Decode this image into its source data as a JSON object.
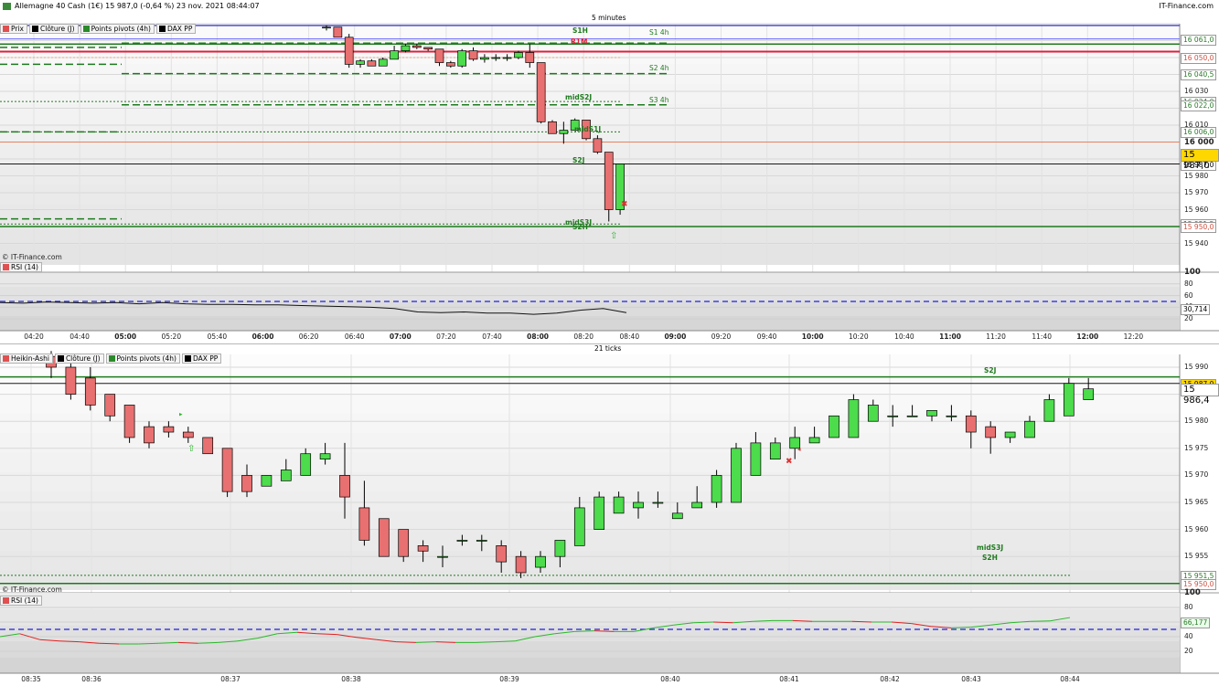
{
  "window": {
    "title": "Allemagne 40 Cash (1€) 15 987,0 (-0,64 %) 23 nov. 2021 08:44:07",
    "brand": "IT-Finance.com"
  },
  "top_chart": {
    "period_label": "5 minutes",
    "legend": [
      "Prix",
      "Clôture (J)",
      "Points pivots (4h)",
      "DAX PP"
    ],
    "legend_colors": [
      "#e05050",
      "#000000",
      "#2a8a2a",
      "#000000"
    ],
    "credit": "© IT-Finance.com",
    "price_labels": [
      "16 061,0",
      "16 050,0",
      "16 040,5",
      "16 030",
      "16 024,0",
      "16 022,0",
      "16 010",
      "16 006,0",
      "16 000",
      "15 980",
      "15 970",
      "15 960",
      "15 951,5",
      "15 950,0",
      "15 940",
      "15 987,0"
    ],
    "current_price": "15 987,0",
    "annotations": [
      "S1H",
      "S1 4h",
      "R1M",
      "S2 4h",
      "midS2J",
      "S3 4h",
      "midS1J",
      "S2J",
      "midS3J",
      "S2H"
    ],
    "rsi_label": "RSI (14)",
    "rsi_axis": [
      "100",
      "80",
      "60",
      "40",
      "20"
    ],
    "rsi_value": "30,714",
    "time_labels": [
      "04:20",
      "04:40",
      "05:00",
      "05:20",
      "05:40",
      "06:00",
      "06:20",
      "06:40",
      "07:00",
      "07:20",
      "07:40",
      "08:00",
      "08:20",
      "08:40",
      "09:00",
      "09:20",
      "09:40",
      "10:00",
      "10:20",
      "10:40",
      "11:00",
      "11:20",
      "11:40",
      "12:00",
      "12:20"
    ],
    "time_labels_bold": [
      "05:00",
      "06:00",
      "07:00",
      "08:00",
      "09:00",
      "10:00",
      "11:00",
      "12:00"
    ]
  },
  "bottom_chart": {
    "period_label": "21 ticks",
    "legend": [
      "Heikin-Ashi",
      "Clôture (J)",
      "Points pivots (4h)",
      "DAX PP"
    ],
    "legend_colors": [
      "#e05050",
      "#000000",
      "#2a8a2a",
      "#000000"
    ],
    "credit": "© IT-Finance.com",
    "price_labels": [
      "15 990",
      "15 987,0",
      "15 980",
      "15 975",
      "15 970",
      "15 965",
      "15 960",
      "15 955",
      "15 951,5",
      "15 950,0"
    ],
    "current_price": "15 986,4",
    "annotations": [
      "S2J",
      "midS3J",
      "S2H"
    ],
    "rsi_label": "RSI (14)",
    "rsi_axis": [
      "100",
      "80",
      "60",
      "40",
      "20"
    ],
    "rsi_value": "66,177",
    "time_labels": [
      "08:35",
      "08:36",
      "08:37",
      "08:38",
      "08:39",
      "08:40",
      "08:41",
      "08:42",
      "08:43",
      "08:44"
    ]
  },
  "colors": {
    "up": "#4cdc4c",
    "down": "#e87070",
    "pivot_green": "#1e7a1e",
    "resistance_red": "#e01e3c",
    "rsi_blue": "#2020e0",
    "current_price_bg": "#ffd700"
  },
  "chart_data": [
    {
      "type": "candlestick",
      "title": "5 minutes",
      "series": [
        {
          "name": "Prix",
          "ohlc": [
            [
              16068,
              16069,
              16066,
              16068
            ],
            [
              16068,
              16068,
              16062,
              16062
            ],
            [
              16062,
              16064,
              16044,
              16046
            ],
            [
              16046,
              16049,
              16044,
              16048
            ],
            [
              16048,
              16049,
              16045,
              16045
            ],
            [
              16045,
              16050,
              16045,
              16049
            ],
            [
              16049,
              16057,
              16049,
              16054
            ],
            [
              16054,
              16058,
              16053,
              16057
            ],
            [
              16057,
              16058,
              16055,
              16056
            ],
            [
              16056,
              16056,
              16054,
              16055
            ],
            [
              16055,
              16055,
              16045,
              16047
            ],
            [
              16047,
              16048,
              16044,
              16045
            ],
            [
              16045,
              16055,
              16044,
              16054
            ],
            [
              16054,
              16056,
              16048,
              16049
            ],
            [
              16049,
              16052,
              16047,
              16050
            ],
            [
              16050,
              16052,
              16048,
              16050
            ],
            [
              16050,
              16052,
              16048,
              16050
            ],
            [
              16050,
              16054,
              16049,
              16053
            ],
            [
              16053,
              16058,
              16044,
              16047
            ],
            [
              16047,
              16047,
              16011,
              16012
            ],
            [
              16012,
              16013,
              16005,
              16005
            ],
            [
              16005,
              16012,
              15999,
              16007
            ],
            [
              16007,
              16014,
              16007,
              16013
            ],
            [
              16013,
              16013,
              16001,
              16002
            ],
            [
              16002,
              16004,
              15993,
              15994
            ],
            [
              15994,
              15994,
              15953,
              15960
            ],
            [
              15960,
              15987,
              15957,
              15987
            ]
          ]
        }
      ],
      "rsi": [
        48,
        47,
        49,
        48,
        47,
        48,
        46,
        48,
        46,
        45,
        45,
        44,
        44,
        43,
        42,
        41,
        40,
        38,
        32,
        31,
        32,
        30,
        30,
        28,
        30,
        35,
        38,
        30.714
      ]
    },
    {
      "type": "candlestick",
      "title": "21 ticks",
      "series": [
        {
          "name": "Heikin-Ashi",
          "ohlc": [
            [
              15992,
              15993,
              15988,
              15990
            ],
            [
              15990,
              15991,
              15984,
              15985
            ],
            [
              15988,
              15990,
              15982,
              15983
            ],
            [
              15985,
              15985,
              15980,
              15981
            ],
            [
              15983,
              15983,
              15976,
              15977
            ],
            [
              15979,
              15980,
              15975,
              15976
            ],
            [
              15979,
              15980,
              15977,
              15978
            ],
            [
              15978,
              15979,
              15976,
              15977
            ],
            [
              15977,
              15977,
              15974,
              15974
            ],
            [
              15975,
              15975,
              15966,
              15967
            ],
            [
              15970,
              15972,
              15966,
              15967
            ],
            [
              15968,
              15970,
              15968,
              15970
            ],
            [
              15969,
              15973,
              15969,
              15971
            ],
            [
              15970,
              15975,
              15970,
              15974
            ],
            [
              15973,
              15976,
              15972,
              15974
            ],
            [
              15970,
              15976,
              15962,
              15966
            ],
            [
              15964,
              15969,
              15957,
              15958
            ],
            [
              15962,
              15962,
              15955,
              15955
            ],
            [
              15960,
              15960,
              15954,
              15955
            ],
            [
              15957,
              15958,
              15954,
              15956
            ],
            [
              15955,
              15957,
              15953,
              15955
            ],
            [
              15958,
              15959,
              15957,
              15958
            ],
            [
              15958,
              15959,
              15956,
              15958
            ],
            [
              15957,
              15958,
              15952,
              15954
            ],
            [
              15955,
              15956,
              15951,
              15952
            ],
            [
              15953,
              15956,
              15952,
              15955
            ],
            [
              15955,
              15958,
              15953,
              15958
            ],
            [
              15957,
              15966,
              15957,
              15964
            ],
            [
              15960,
              15967,
              15960,
              15966
            ],
            [
              15963,
              15967,
              15963,
              15966
            ],
            [
              15964,
              15967,
              15962,
              15965
            ],
            [
              15965,
              15967,
              15964,
              15965
            ],
            [
              15962,
              15965,
              15962,
              15963
            ],
            [
              15964,
              15968,
              15964,
              15965
            ],
            [
              15965,
              15971,
              15964,
              15970
            ],
            [
              15965,
              15976,
              15965,
              15975
            ],
            [
              15970,
              15978,
              15970,
              15976
            ],
            [
              15973,
              15977,
              15973,
              15976
            ],
            [
              15975,
              15979,
              15973,
              15977
            ],
            [
              15976,
              15979,
              15976,
              15977
            ],
            [
              15977,
              15981,
              15977,
              15981
            ],
            [
              15977,
              15985,
              15977,
              15984
            ],
            [
              15980,
              15984,
              15980,
              15983
            ],
            [
              15981,
              15983,
              15979,
              15981
            ],
            [
              15981,
              15983,
              15981,
              15981
            ],
            [
              15981,
              15982,
              15980,
              15982
            ],
            [
              15981,
              15983,
              15980,
              15981
            ],
            [
              15981,
              15982,
              15975,
              15978
            ],
            [
              15979,
              15980,
              15974,
              15977
            ],
            [
              15977,
              15978,
              15976,
              15978
            ],
            [
              15977,
              15981,
              15977,
              15980
            ],
            [
              15980,
              15985,
              15980,
              15984
            ],
            [
              15981,
              15988,
              15981,
              15987
            ],
            [
              15984,
              15988,
              15984,
              15986
            ]
          ]
        }
      ],
      "rsi": [
        40,
        44,
        36,
        34,
        33,
        31,
        30,
        30,
        31,
        32,
        31,
        32,
        34,
        38,
        44,
        46,
        44,
        43,
        39,
        36,
        33,
        32,
        33,
        32,
        32,
        33,
        34,
        40,
        44,
        47,
        48,
        47,
        47,
        52,
        56,
        59,
        60,
        59,
        61,
        62,
        62,
        61,
        61,
        61,
        60,
        60,
        58,
        54,
        52,
        53,
        56,
        59,
        61,
        61.6,
        66.177
      ]
    }
  ]
}
